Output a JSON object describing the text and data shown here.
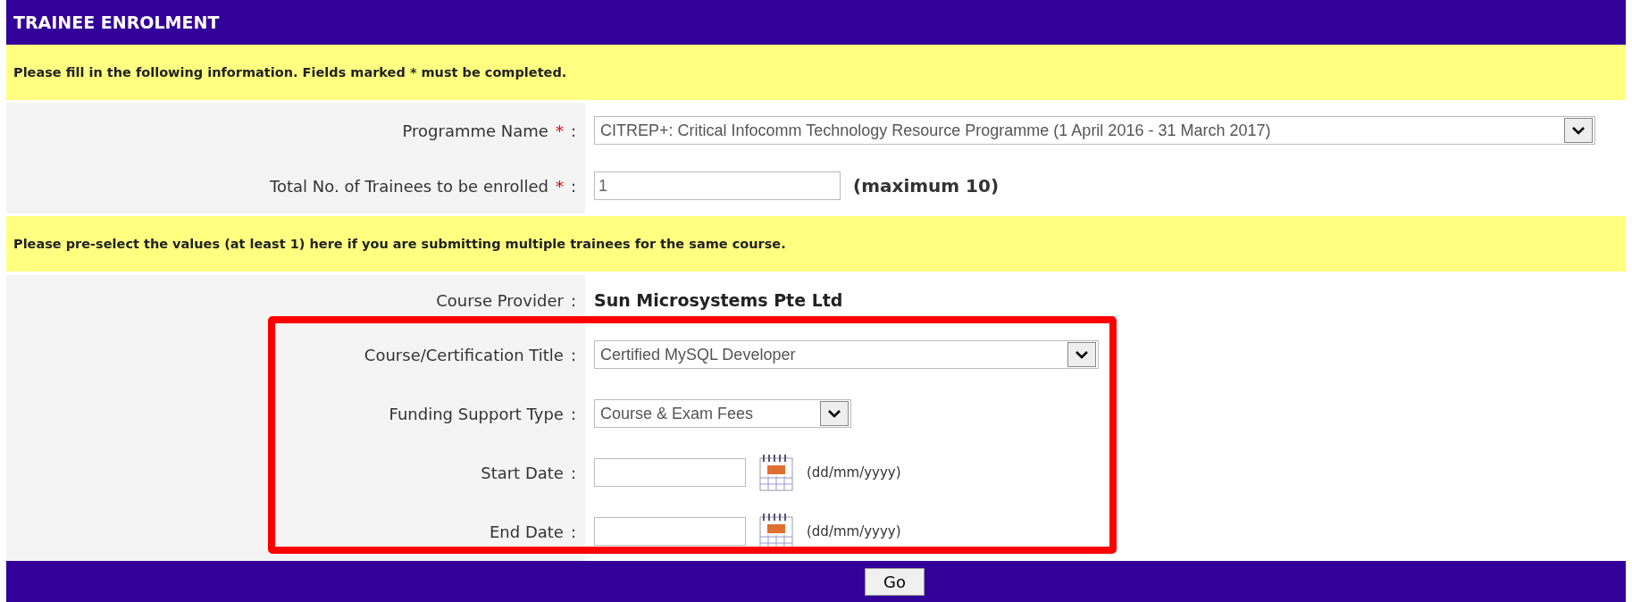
{
  "header": {
    "title": "TRAINEE ENROLMENT"
  },
  "notice_1": "Please fill in the following information. Fields marked * must be completed.",
  "fields_1": [
    {
      "kind": "select",
      "label": "Programme Name",
      "required_mark": "*",
      "colon": ":",
      "value": "CITREP+: Critical Infocomm Technology Resource Programme (1 April 2016 - 31 March 2017)"
    },
    {
      "kind": "input",
      "label": "Total No. of Trainees to be enrolled",
      "required_mark": "*",
      "colon": ":",
      "value": "1",
      "note": "(maximum 10)"
    }
  ],
  "notice_2": "Please pre-select the values (at least 1) here if you are submitting multiple trainees for the same course.",
  "fields_2": [
    {
      "kind": "text",
      "label": "Course Provider",
      "colon": ":",
      "value": "Sun Microsystems Pte Ltd"
    }
  ],
  "highlighted_group": {
    "highlighted": true,
    "fields": [
      {
        "kind": "select",
        "label": "Course/Certification Title",
        "colon": ":",
        "value": "Certified MySQL Developer"
      },
      {
        "kind": "select",
        "label": "Funding Support Type",
        "colon": ":",
        "value": "Course & Exam Fees"
      },
      {
        "kind": "date",
        "label": "Start Date",
        "colon": ":",
        "note": "(dd/mm/yyyy)"
      },
      {
        "kind": "date",
        "label": "End Date",
        "colon": ":",
        "note": "(dd/mm/yyyy)"
      }
    ]
  },
  "footer": {
    "button": "Go"
  }
}
